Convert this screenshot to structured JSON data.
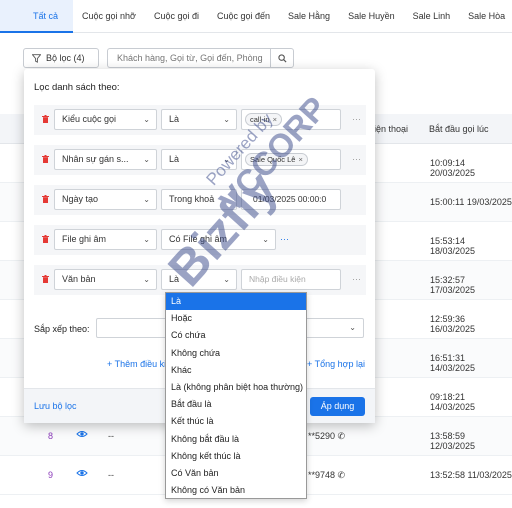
{
  "tabs": [
    {
      "label": "Tất cả",
      "active": true
    },
    {
      "label": "Cuộc gọi nhỡ"
    },
    {
      "label": "Cuộc gọi đi"
    },
    {
      "label": "Cuộc gọi đến"
    },
    {
      "label": "Sale Hằng"
    },
    {
      "label": "Sale Huyền"
    },
    {
      "label": "Sale Linh"
    },
    {
      "label": "Sale Hòa"
    }
  ],
  "toolbar": {
    "filter_label": "Bộ lọc (4)",
    "search_placeholder": "Khách hàng, Gọi từ, Gọi đến, Phòng"
  },
  "table": {
    "headers": {
      "phone": "iện thoại",
      "start_time": "Bắt đầu gọi lúc"
    },
    "times": [
      "10:09:14 20/03/2025",
      "15:00:11 19/03/2025",
      "15:53:14 18/03/2025",
      "15:32:57 17/03/2025",
      "12:59:36 16/03/2025",
      "16:51:31 14/03/2025",
      "09:18:21 14/03/2025",
      "13:58:59 12/03/2025",
      "13:52:58 11/03/2025"
    ],
    "visible_rows": [
      {
        "num": "8",
        "dash1": "--",
        "dash2": "--",
        "phone": "**5290"
      },
      {
        "num": "9",
        "dash1": "--",
        "dash2": "--",
        "phone": "**9748"
      }
    ]
  },
  "filter_panel": {
    "title": "Lọc danh sách theo:",
    "rows": [
      {
        "field": "Kiểu cuộc gọi",
        "operator": "Là",
        "tag": "call-in"
      },
      {
        "field": "Nhân sự gán s...",
        "operator": "Là",
        "tag": "Sale Quốc Lê"
      },
      {
        "field": "Ngày tạo",
        "operator": "Trong khoả",
        "value": "01/03/2025 00:00:0"
      },
      {
        "field": "File ghi âm",
        "operator": "Có File ghi âm"
      },
      {
        "field": "Văn bản",
        "operator": "Là",
        "placeholder": "Nhập điều kiện"
      }
    ],
    "sort_label": "Sắp xếp theo:",
    "add_condition": "+ Thêm điều ki",
    "aggregate": "+ Tổng hợp lại",
    "save_filter": "Lưu bộ lọc",
    "apply": "Áp dụng"
  },
  "operator_dropdown": {
    "options": [
      "Là",
      "Hoặc",
      "Có chứa",
      "Không chứa",
      "Khác",
      "Là (không phân biệt hoa thường)",
      "Bắt đầu là",
      "Kết thúc là",
      "Không bắt đầu là",
      "Không kết thúc là",
      "Có Văn bản",
      "Không có Văn bản"
    ],
    "selected_index": 0
  },
  "watermark": {
    "brand": "Bizfly",
    "powered": "Powered by",
    "corp": "VCCORP"
  },
  "colors": {
    "accent": "#1a73e8",
    "delete": "#e53935",
    "row_number": "#8a3ab9"
  }
}
